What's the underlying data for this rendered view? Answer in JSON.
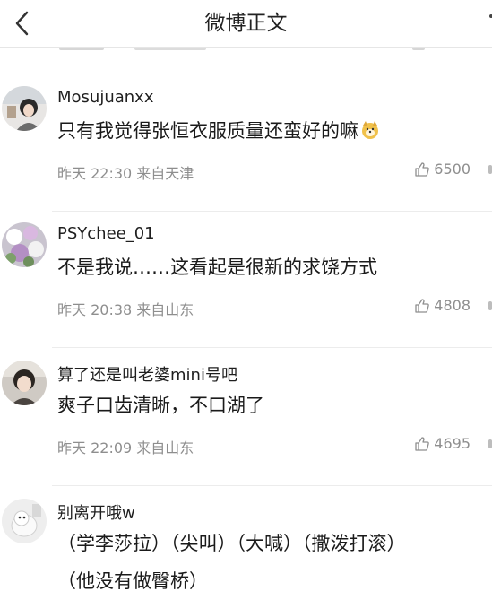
{
  "header": {
    "title": "微博正文",
    "back_icon": "chevron-left-icon"
  },
  "comments": [
    {
      "username": "Mosujuanxx",
      "content": "只有我觉得张恒衣服质量还蛮好的嘛",
      "time": "昨天 22:30",
      "source": "来自天津",
      "likes": "6500",
      "emoji": "doge-emoji"
    },
    {
      "username": "PSYchee_01",
      "content": "不是我说……这看起是很新的求饶方式",
      "time": "昨天 20:38",
      "source": "来自山东",
      "likes": "4808"
    },
    {
      "username": "算了还是叫老婆mini号吧",
      "content": "爽子口齿清晰，不口湖了",
      "time": "昨天 22:09",
      "source": "来自山东",
      "likes": "4695"
    },
    {
      "username": "别离开哦w",
      "content": "（学李莎拉）（尖叫）（大喊）（撒泼打滚）",
      "content_line2": "（他没有做臀桥）"
    }
  ],
  "colors": {
    "meta": "#8e8e8e",
    "divider": "#ececec",
    "text": "#1a1a1a"
  }
}
